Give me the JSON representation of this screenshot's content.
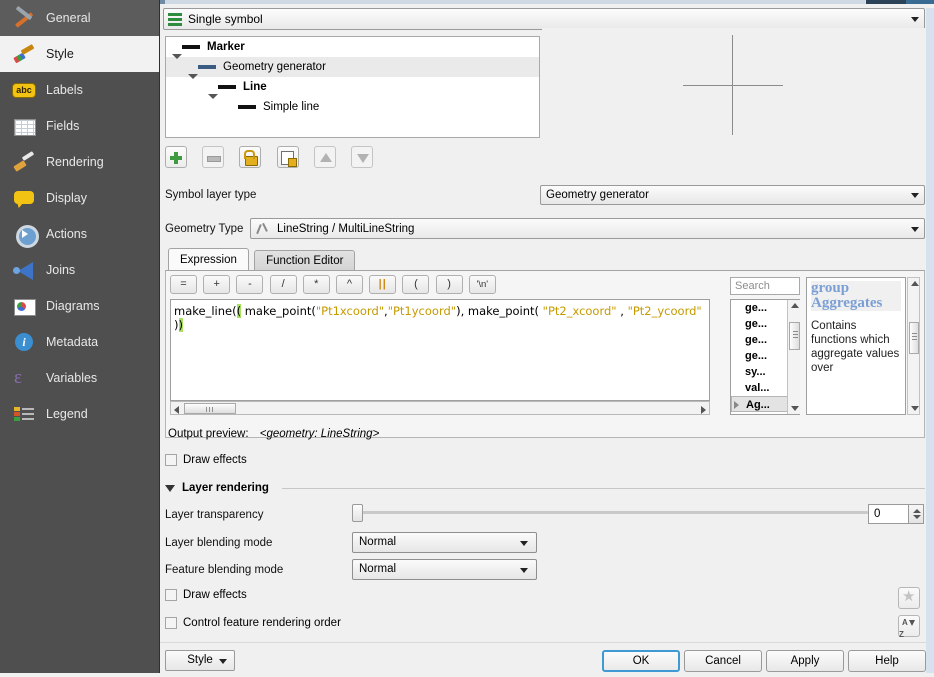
{
  "sidebar": {
    "items": [
      {
        "label": "General",
        "icon": "hammer-wrench-icon",
        "state": "hover"
      },
      {
        "label": "Style",
        "icon": "paintbrush-icon",
        "state": "active"
      },
      {
        "label": "Labels",
        "icon": "abc-label-icon",
        "state": "normal"
      },
      {
        "label": "Fields",
        "icon": "table-grid-icon",
        "state": "normal"
      },
      {
        "label": "Rendering",
        "icon": "brush-icon",
        "state": "normal"
      },
      {
        "label": "Display",
        "icon": "speech-bubble-icon",
        "state": "normal"
      },
      {
        "label": "Actions",
        "icon": "gear-play-icon",
        "state": "normal"
      },
      {
        "label": "Joins",
        "icon": "join-arrow-icon",
        "state": "normal"
      },
      {
        "label": "Diagrams",
        "icon": "pie-chart-icon",
        "state": "normal"
      },
      {
        "label": "Metadata",
        "icon": "info-circle-icon",
        "state": "normal"
      },
      {
        "label": "Variables",
        "icon": "epsilon-icon",
        "state": "normal"
      },
      {
        "label": "Legend",
        "icon": "legend-list-icon",
        "state": "normal"
      }
    ]
  },
  "renderer": {
    "value": "Single symbol",
    "icon": "single-symbol-icon"
  },
  "symbol_tree": [
    {
      "label": "Marker",
      "depth": 0,
      "bold": true,
      "swatch": "black",
      "expanded": true,
      "selected": false
    },
    {
      "label": "Geometry generator",
      "depth": 1,
      "bold": false,
      "swatch": "blue",
      "expanded": true,
      "selected": true
    },
    {
      "label": "Line",
      "depth": 2,
      "bold": true,
      "swatch": "black",
      "expanded": true,
      "selected": false
    },
    {
      "label": "Simple line",
      "depth": 3,
      "bold": false,
      "swatch": "black",
      "expanded": false,
      "selected": false
    }
  ],
  "symbol_toolbar": [
    {
      "name": "add-symbol-layer-button",
      "icon": "plus-icon",
      "enabled": true
    },
    {
      "name": "remove-symbol-layer-button",
      "icon": "minus-icon",
      "enabled": false
    },
    {
      "name": "lock-layer-colors-button",
      "icon": "padlock-icon",
      "enabled": true
    },
    {
      "name": "duplicate-layer-button",
      "icon": "duplicate-icon",
      "enabled": true
    },
    {
      "name": "move-layer-up-button",
      "icon": "triangle-up-icon",
      "enabled": false
    },
    {
      "name": "move-layer-down-button",
      "icon": "triangle-down-icon",
      "enabled": false
    }
  ],
  "symbol_layer_type": {
    "label": "Symbol layer type",
    "value": "Geometry generator"
  },
  "geometry_type": {
    "label": "Geometry Type",
    "value": "LineString / MultiLineString",
    "icon": "polyline-icon"
  },
  "tabs": [
    {
      "label": "Expression",
      "active": true
    },
    {
      "label": "Function Editor",
      "active": false
    }
  ],
  "operators": [
    "=",
    "+",
    "-",
    "/",
    "*",
    "^",
    "||",
    "(",
    ")",
    "'\\n'"
  ],
  "expression": {
    "parts": [
      {
        "t": "make_line(",
        "k": "fn-open"
      },
      {
        "t": " make_point(",
        "k": "fn"
      },
      {
        "t": "\"Pt1xcoord\"",
        "k": "field"
      },
      {
        "t": ",",
        "k": "fn"
      },
      {
        "t": "\"Pt1ycoord\"",
        "k": "field"
      },
      {
        "t": "), make_point( ",
        "k": "fn"
      },
      {
        "t": "\"Pt2_xcoord\"",
        "k": "field"
      },
      {
        "t": " , ",
        "k": "fn"
      },
      {
        "t": "\"Pt2_ycoord\"",
        "k": "field"
      },
      {
        "t": " )",
        "k": "fn"
      },
      {
        "t": ")",
        "k": "fn-close"
      }
    ],
    "full_text": "make_line( make_point(\"Pt1xcoord\",\"Pt1ycoord\"), make_point( \"Pt2_xcoord\" , \"Pt2_ycoord\" ))"
  },
  "search": {
    "placeholder": "Search",
    "value": ""
  },
  "function_list": [
    {
      "label": "ge...",
      "selected": false,
      "expandable": false
    },
    {
      "label": "ge...",
      "selected": false,
      "expandable": false
    },
    {
      "label": "ge...",
      "selected": false,
      "expandable": false
    },
    {
      "label": "ge...",
      "selected": false,
      "expandable": false
    },
    {
      "label": "sy...",
      "selected": false,
      "expandable": false
    },
    {
      "label": "val...",
      "selected": false,
      "expandable": false
    },
    {
      "label": "Ag...",
      "selected": true,
      "expandable": true
    }
  ],
  "help": {
    "title": "group Aggregates",
    "body": "Contains functions which aggregate values over"
  },
  "output_preview": {
    "label": "Output preview:",
    "value": "<geometry: LineString>"
  },
  "draw_effects_top": {
    "label": "Draw effects",
    "checked": false
  },
  "layer_rendering": {
    "title": "Layer rendering",
    "expanded": true,
    "transparency": {
      "label": "Layer transparency",
      "value": "0"
    },
    "layer_blending": {
      "label": "Layer blending mode",
      "value": "Normal"
    },
    "feature_blending": {
      "label": "Feature blending mode",
      "value": "Normal"
    },
    "draw_effects": {
      "label": "Draw effects",
      "checked": false
    },
    "control_order": {
      "label": "Control feature rendering order",
      "checked": false
    }
  },
  "bottom": {
    "style_button": "Style",
    "ok": "OK",
    "cancel": "Cancel",
    "apply": "Apply",
    "help": "Help"
  },
  "colors": {
    "accent": "#3f9ad4",
    "sidebar_bg": "#4f4f4f",
    "field_text": "#c59a00",
    "paren_highlight": "#a8e060",
    "help_title": "#7b9fd4"
  }
}
